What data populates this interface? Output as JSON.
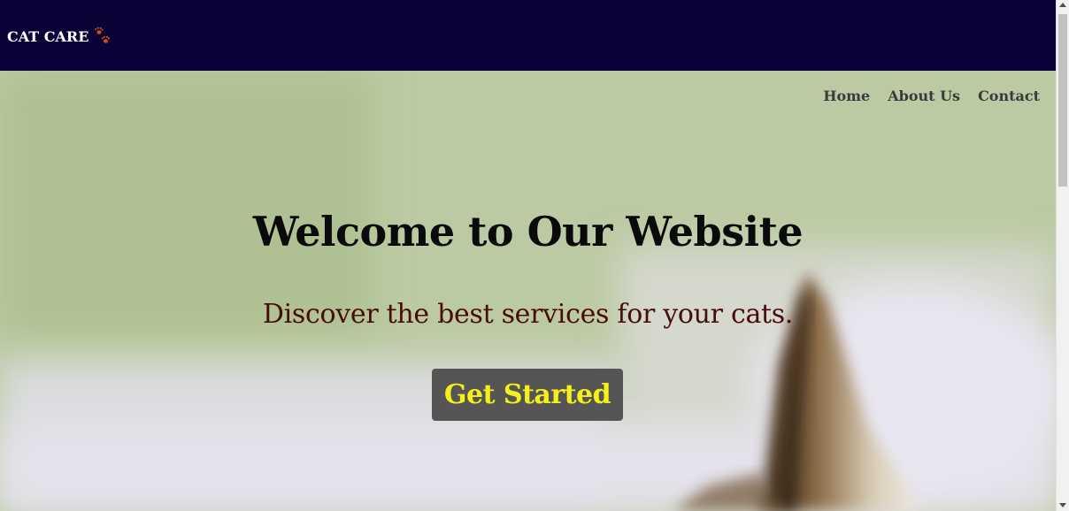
{
  "header": {
    "logo_text": "CAT CARE",
    "logo_icon": "paw-prints-icon",
    "background_color": "#0b0338"
  },
  "nav": {
    "items": [
      {
        "label": "Home"
      },
      {
        "label": "About Us"
      },
      {
        "label": "Contact"
      }
    ]
  },
  "hero": {
    "title": "Welcome to Our Website",
    "subtitle": "Discover the best services for your cats.",
    "cta_label": "Get Started",
    "background_image": "blurred-cat-photo",
    "title_color": "#0a0a0a",
    "subtitle_color": "#4a0b0b",
    "cta_bg_color": "#555555",
    "cta_text_color": "#f5f01a"
  }
}
